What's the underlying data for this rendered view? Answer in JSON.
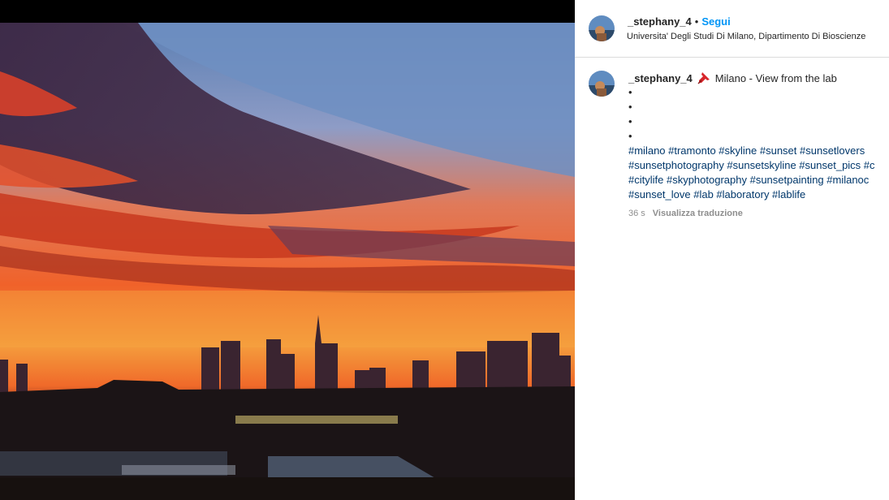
{
  "post": {
    "username": "_stephany_4",
    "separator": "•",
    "follow_label": "Segui",
    "location": "Universita' Degli Studi Di Milano, Dipartimento Di Bioscienze",
    "image_icon": "sunset-skyline-photo"
  },
  "caption": {
    "username": "_stephany_4",
    "pin_icon": "pushpin-icon",
    "text": "Milano - View from the lab",
    "bullets": [
      "•",
      "•",
      "•",
      "•"
    ],
    "hashtag_lines": [
      "#milano #tramonto #skyline #sunset #sunsetlovers",
      "#sunsetphotography #sunsetskyline #sunset_pics #c",
      "#citylife #skyphotography #sunsetpainting #milanoc",
      "#sunset_love #lab #laboratory #lablife"
    ],
    "time": "36 s",
    "translate_label": "Visualizza traduzione"
  },
  "colors": {
    "follow": "#0095f6",
    "hashtag": "#00376b",
    "muted": "#8e8e8e"
  }
}
